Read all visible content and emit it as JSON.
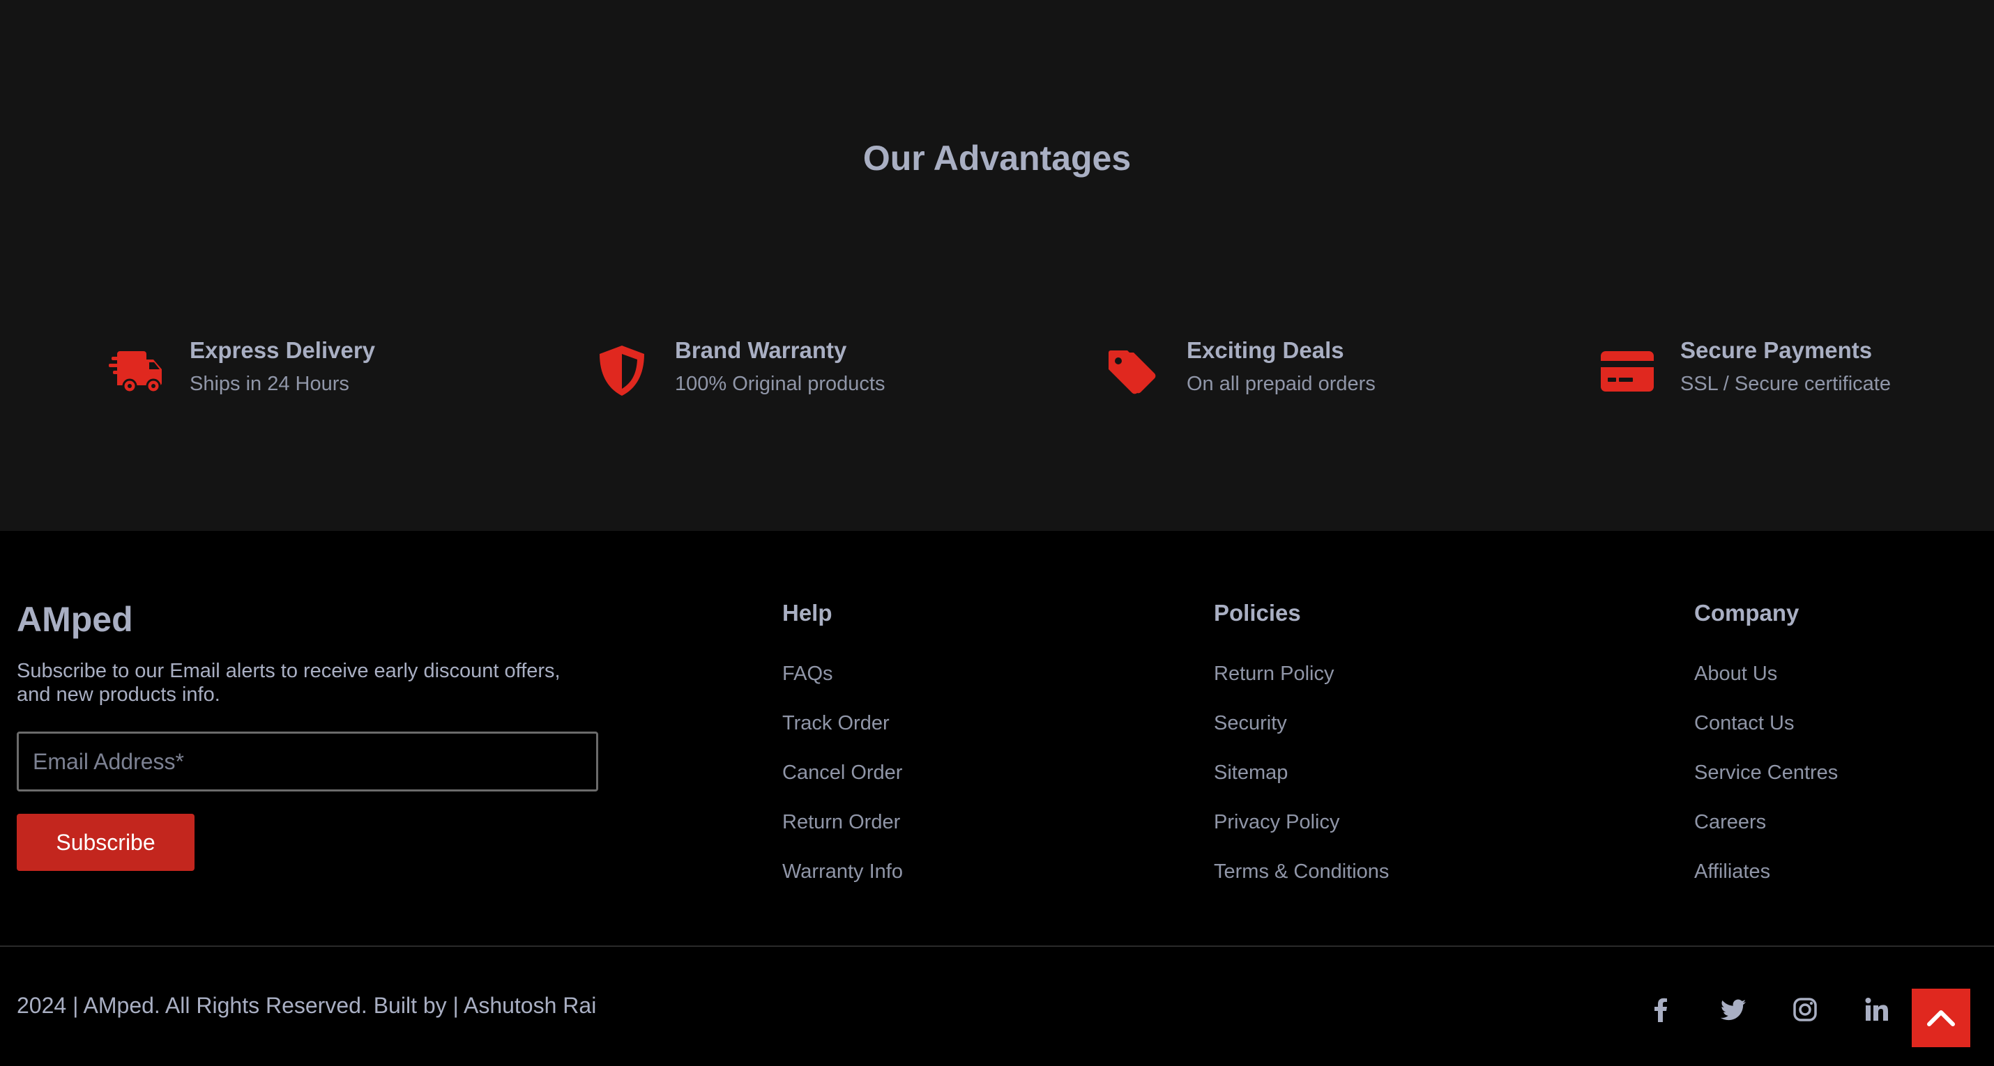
{
  "advantages": {
    "title": "Our Advantages",
    "items": [
      {
        "title": "Express Delivery",
        "subtitle": "Ships in 24 Hours",
        "icon": "truck-icon"
      },
      {
        "title": "Brand Warranty",
        "subtitle": "100% Original products",
        "icon": "shield-icon"
      },
      {
        "title": "Exciting Deals",
        "subtitle": "On all prepaid orders",
        "icon": "tags-icon"
      },
      {
        "title": "Secure Payments",
        "subtitle": "SSL / Secure certificate",
        "icon": "credit-card-icon"
      }
    ]
  },
  "footer": {
    "brand": "AMped",
    "blurb": "Subscribe to our Email alerts to receive early discount offers, and new products info.",
    "email_placeholder": "Email Address*",
    "subscribe_label": "Subscribe",
    "columns": [
      {
        "heading": "Help",
        "links": [
          "FAQs",
          "Track Order",
          "Cancel Order",
          "Return Order",
          "Warranty Info"
        ]
      },
      {
        "heading": "Policies",
        "links": [
          "Return Policy",
          "Security",
          "Sitemap",
          "Privacy Policy",
          "Terms & Conditions"
        ]
      },
      {
        "heading": "Company",
        "links": [
          "About Us",
          "Contact Us",
          "Service Centres",
          "Careers",
          "Affiliates"
        ]
      }
    ],
    "copyright": "2024 | AMped. All Rights Reserved. Built by | Ashutosh Rai",
    "social": [
      "facebook-icon",
      "twitter-icon",
      "instagram-icon",
      "linkedin-icon"
    ],
    "scroll_top_icon": "chevron-up-icon"
  },
  "colors": {
    "accent": "#e0281f",
    "button": "#c3261e",
    "text": "#a9afc3",
    "section_bg": "#141414",
    "footer_bg": "#000000"
  }
}
